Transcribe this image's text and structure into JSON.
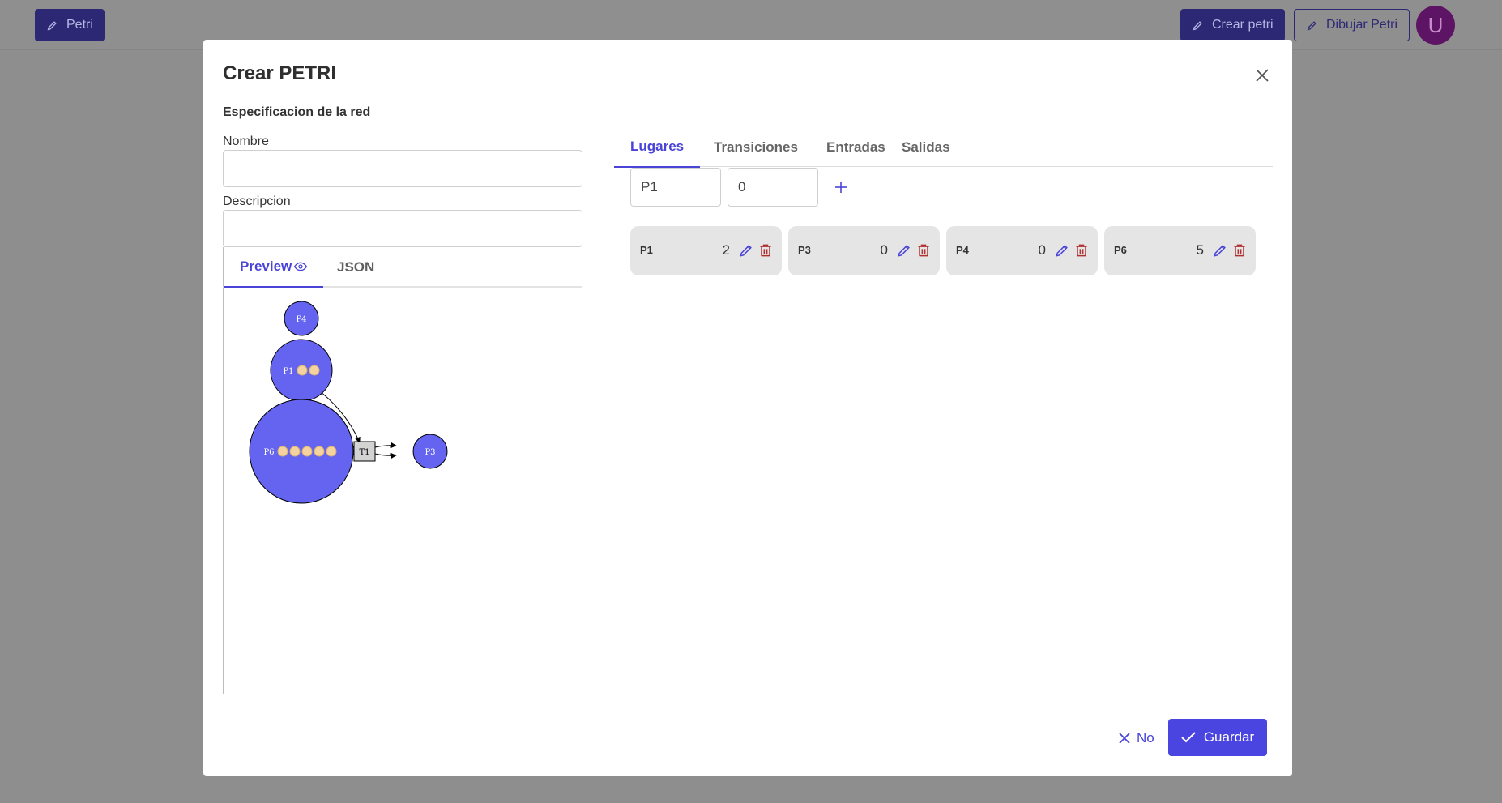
{
  "background": {
    "petri_button": "Petri",
    "crear_button": "Crear petri",
    "dibujar_button": "Dibujar Petri",
    "avatar_letter": "U"
  },
  "modal": {
    "title": "Crear PETRI",
    "section_title": "Especificacion de la red",
    "nombre_label": "Nombre",
    "nombre_value": "",
    "descripcion_label": "Descripcion",
    "descripcion_value": "",
    "left_tabs": [
      {
        "label": "Preview",
        "active": true,
        "icon": "eye-icon"
      },
      {
        "label": "JSON",
        "active": false
      }
    ],
    "right_tabs": [
      {
        "label": "Lugares",
        "active": true
      },
      {
        "label": "Transiciones",
        "active": false
      },
      {
        "label": "Entradas",
        "active": false
      },
      {
        "label": "Salidas",
        "active": false
      }
    ],
    "place_name_input": "P1",
    "place_tokens_input": "0",
    "places": [
      {
        "name": "P1",
        "tokens": "2"
      },
      {
        "name": "P3",
        "tokens": "0"
      },
      {
        "name": "P4",
        "tokens": "0"
      },
      {
        "name": "P6",
        "tokens": "5"
      }
    ],
    "no_button": "No",
    "save_button": "Guardar"
  },
  "graph": {
    "places": [
      {
        "id": "P4",
        "tokens": 0
      },
      {
        "id": "P1",
        "tokens": 2
      },
      {
        "id": "P6",
        "tokens": 5
      },
      {
        "id": "P3",
        "tokens": 0
      }
    ],
    "transitions": [
      {
        "id": "T1"
      }
    ],
    "arcs": [
      [
        "P1",
        "T1"
      ],
      [
        "P6",
        "T1"
      ],
      [
        "P6",
        "T1"
      ],
      [
        "T1",
        "P3"
      ],
      [
        "T1",
        "P3"
      ]
    ]
  },
  "colors": {
    "accent": "#4a44d6",
    "place_fill": "#6464f0",
    "token_fill": "#f4d3a0",
    "delete_red": "#b03030"
  }
}
